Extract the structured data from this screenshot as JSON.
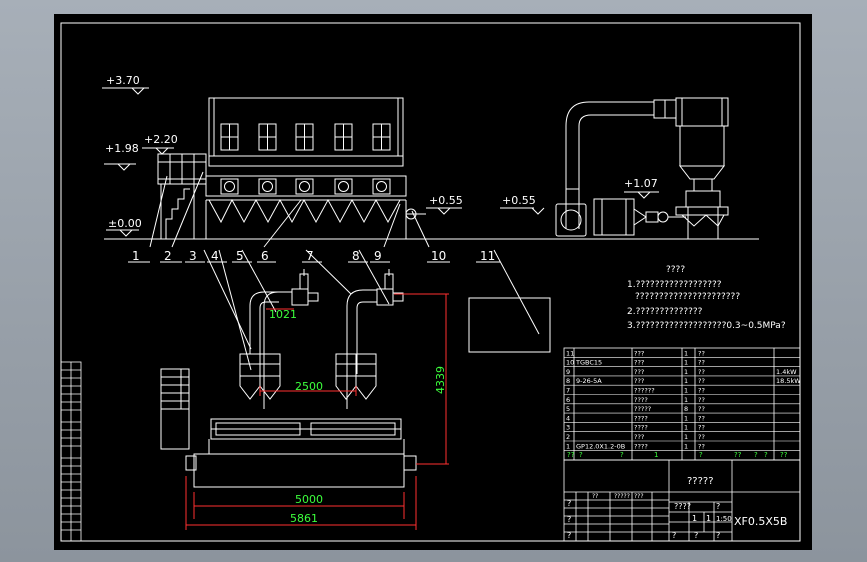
{
  "elevations": {
    "e370": "+3.70",
    "e198": "+1.98",
    "e220": "+2.20",
    "e000": "±0.00",
    "e055a": "+0.55",
    "e055b": "+0.55",
    "e107": "+1.07"
  },
  "callouts": [
    "1",
    "2",
    "3",
    "4",
    "5",
    "6",
    "7",
    "8",
    "9",
    "10",
    "11"
  ],
  "dimensions": {
    "d1021": "1021",
    "d2500": "2500",
    "d4339": "4339",
    "d5000": "5000",
    "d5861": "5861"
  },
  "notes": {
    "title": "????",
    "n1a": "1.??????????????????",
    "n1b": "??????????????????????",
    "n2": "2.??????????????",
    "n3": "3.???????????????????0.3~0.5MPa?"
  },
  "parts_list": {
    "rows": [
      {
        "no": "11",
        "code": "",
        "name": "???",
        "qty": "1",
        "mat": "??",
        "rem": ""
      },
      {
        "no": "10",
        "code": "TGBC15",
        "name": "???",
        "qty": "1",
        "mat": "??",
        "rem": ""
      },
      {
        "no": "9",
        "code": "",
        "name": "???",
        "qty": "1",
        "mat": "??",
        "rem": "1.4kW"
      },
      {
        "no": "8",
        "code": "9-26-5A",
        "name": "???",
        "qty": "1",
        "mat": "??",
        "rem": "18.5kW"
      },
      {
        "no": "7",
        "code": "",
        "name": "??????",
        "qty": "1",
        "mat": "??",
        "rem": ""
      },
      {
        "no": "6",
        "code": "",
        "name": "????",
        "qty": "1",
        "mat": "??",
        "rem": ""
      },
      {
        "no": "5",
        "code": "",
        "name": "?????",
        "qty": "8",
        "mat": "??",
        "rem": ""
      },
      {
        "no": "4",
        "code": "",
        "name": "????",
        "qty": "1",
        "mat": "??",
        "rem": ""
      },
      {
        "no": "3",
        "code": "",
        "name": "????",
        "qty": "1",
        "mat": "??",
        "rem": ""
      },
      {
        "no": "2",
        "code": "",
        "name": "???",
        "qty": "1",
        "mat": "??",
        "rem": ""
      },
      {
        "no": "1",
        "code": "GP12.0X1.2-0B",
        "name": "????",
        "qty": "1",
        "mat": "??",
        "rem": ""
      }
    ],
    "header": [
      "??",
      "?",
      "?",
      "1",
      "?",
      "??",
      "?",
      "?",
      "??"
    ]
  },
  "title_block": {
    "drawing_name": "?????",
    "drawing_code": "XF0.5X5B",
    "scale": "1:50",
    "q1": "????",
    "q2": "?",
    "q3": "?",
    "q4": "?",
    "r1": "?",
    "r2": "?",
    "r3": "?",
    "r4": "?",
    "c1": "?????",
    "c2": "??",
    "c3": "???",
    "one": "1",
    "one2": "1"
  }
}
